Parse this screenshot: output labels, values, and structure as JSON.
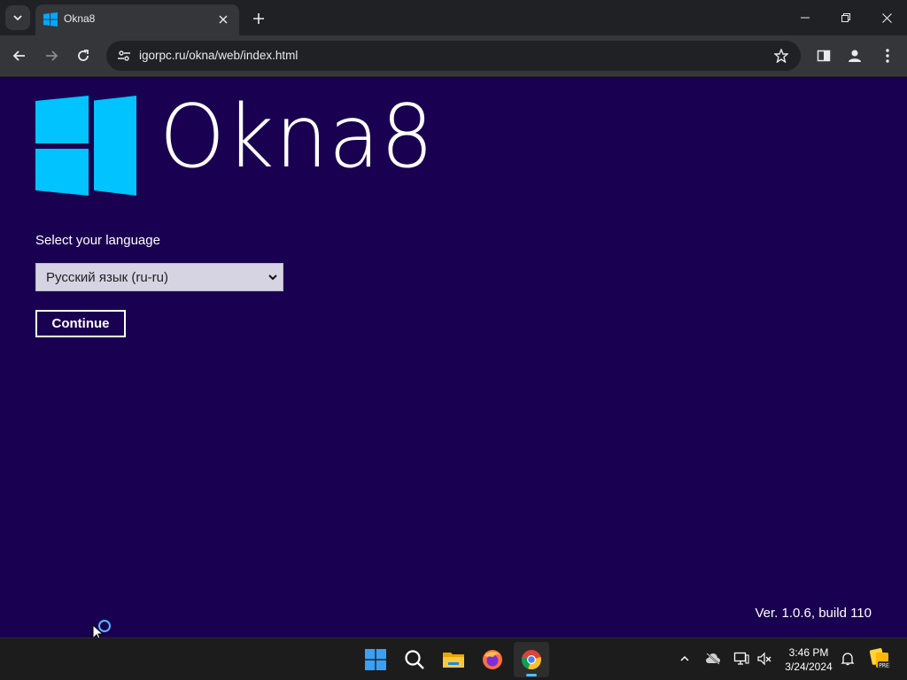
{
  "browser": {
    "tab_title": "Okna8",
    "url": "igorpc.ru/okna/web/index.html"
  },
  "page": {
    "brand_name": "Okna8",
    "language_label": "Select your language",
    "language_selected": "Русский язык (ru-ru)",
    "continue_label": "Continue",
    "version": "Ver. 1.0.6, build 110",
    "background_color": "#1a0050",
    "logo_color": "#00c3ff"
  },
  "taskbar": {
    "apps": [
      "start-icon",
      "search-icon",
      "file-explorer-icon",
      "firefox-icon",
      "chrome-icon"
    ],
    "time": "3:46 PM",
    "date": "3/24/2024"
  }
}
